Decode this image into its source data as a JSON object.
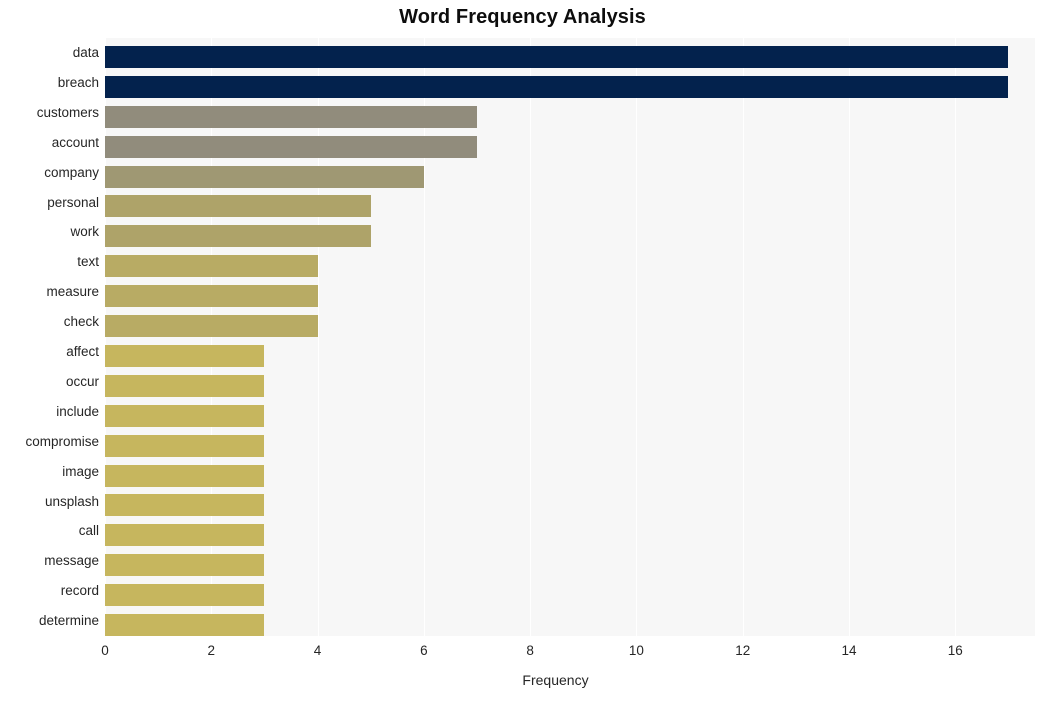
{
  "chart_data": {
    "type": "bar",
    "orientation": "horizontal",
    "title": "Word Frequency Analysis",
    "xlabel": "Frequency",
    "ylabel": "",
    "xlim": [
      0,
      17.5
    ],
    "xticks": [
      0,
      2,
      4,
      6,
      8,
      10,
      12,
      14,
      16
    ],
    "grid": true,
    "legend": false,
    "categories": [
      "data",
      "breach",
      "customers",
      "account",
      "company",
      "personal",
      "work",
      "text",
      "measure",
      "check",
      "affect",
      "occur",
      "include",
      "compromise",
      "image",
      "unsplash",
      "call",
      "message",
      "record",
      "determine"
    ],
    "values": [
      17,
      17,
      7,
      7,
      6,
      5,
      5,
      4,
      4,
      4,
      3,
      3,
      3,
      3,
      3,
      3,
      3,
      3,
      3,
      3
    ],
    "bar_colors": [
      "#03224d",
      "#03224d",
      "#918c7c",
      "#918c7c",
      "#9f9873",
      "#aea369",
      "#aea369",
      "#b8ab64",
      "#b8ab64",
      "#b8ab64",
      "#c6b65e",
      "#c6b65e",
      "#c6b65e",
      "#c6b65e",
      "#c6b65e",
      "#c6b65e",
      "#c6b65e",
      "#c6b65e",
      "#c6b65e",
      "#c6b65e"
    ],
    "plot_background": "#f7f7f7",
    "gridline_color": "#ffffff",
    "page_background": "#ffffff",
    "text_color": "#262626",
    "title_color": "#0d0d0d"
  }
}
